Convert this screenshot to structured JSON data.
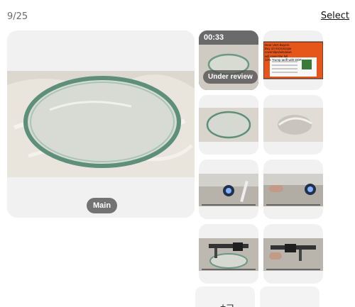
{
  "header": {
    "counter": "9/25",
    "select_label": "Select"
  },
  "main_image": {
    "badge": "Main",
    "subject": "clear glass disc on plastic wrap"
  },
  "thumbnails": [
    {
      "type": "video",
      "duration": "00:33",
      "status": "Under review"
    },
    {
      "type": "image",
      "content": "advertisement banner",
      "text": "Dear USA Buyers\nBuy 10 microscope coverslips/windows\nwill cover the full\n10% Trump tariff with DDP."
    },
    {
      "type": "image",
      "content": "glass disc on plastic"
    },
    {
      "type": "image",
      "content": "glass disc wrapped in film"
    },
    {
      "type": "image",
      "content": "hand holding glass with flashlight"
    },
    {
      "type": "image",
      "content": "glass with flashlight close-up"
    },
    {
      "type": "image",
      "content": "caliper measuring disc diameter"
    },
    {
      "type": "image",
      "content": "caliper measuring disc thickness"
    }
  ],
  "add_buttons": [
    {
      "icon": "add-icon",
      "glyph": "+⊐"
    },
    {
      "icon": "add-icon",
      "glyph": ""
    }
  ],
  "colors": {
    "card_bg": "#f1f1f1",
    "pill_bg": "#505050",
    "ad_bg": "#e6561b"
  }
}
